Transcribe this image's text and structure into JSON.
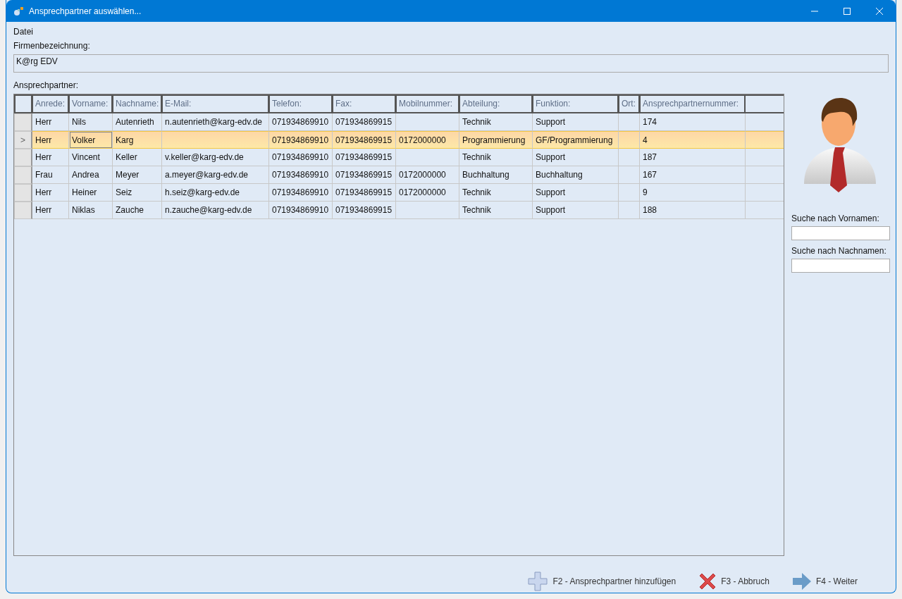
{
  "window": {
    "title": "Ansprechpartner auswählen..."
  },
  "menu": [
    {
      "label": "Datei"
    }
  ],
  "company": {
    "label": "Firmenbezeichnung:",
    "value": "K@rg EDV"
  },
  "contacts_label": "Ansprechpartner:",
  "table": {
    "current_glyph": ">",
    "columns": [
      "Anrede:",
      "Vorname:",
      "Nachname:",
      "E-Mail:",
      "Telefon:",
      "Fax:",
      "Mobilnummer:",
      "Abteilung:",
      "Funktion:",
      "Ort:",
      "Ansprechpartnernummer:"
    ],
    "rows": [
      {
        "selected": false,
        "cells": [
          {
            "text": "Herr",
            "focused": false
          },
          {
            "text": "Nils",
            "focused": false
          },
          {
            "text": "Autenrieth",
            "focused": false
          },
          {
            "text": "n.autenrieth@karg-edv.de",
            "focused": false
          },
          {
            "text": "071934869910",
            "focused": false
          },
          {
            "text": "071934869915",
            "focused": false
          },
          {
            "text": "",
            "focused": false
          },
          {
            "text": "Technik",
            "focused": false
          },
          {
            "text": "Support",
            "focused": false
          },
          {
            "text": "",
            "focused": false
          },
          {
            "text": "174",
            "focused": false
          }
        ]
      },
      {
        "selected": true,
        "cells": [
          {
            "text": "Herr",
            "focused": false
          },
          {
            "text": "Volker",
            "focused": true
          },
          {
            "text": "Karg",
            "focused": false
          },
          {
            "text": "",
            "focused": false
          },
          {
            "text": "071934869910",
            "focused": false
          },
          {
            "text": "071934869915",
            "focused": false
          },
          {
            "text": "0172000000",
            "focused": false
          },
          {
            "text": "Programmierung",
            "focused": false
          },
          {
            "text": "GF/Programmierung",
            "focused": false
          },
          {
            "text": "",
            "focused": false
          },
          {
            "text": "4",
            "focused": false
          }
        ]
      },
      {
        "selected": false,
        "cells": [
          {
            "text": "Herr",
            "focused": false
          },
          {
            "text": "Vincent",
            "focused": false
          },
          {
            "text": "Keller",
            "focused": false
          },
          {
            "text": "v.keller@karg-edv.de",
            "focused": false
          },
          {
            "text": "071934869910",
            "focused": false
          },
          {
            "text": "071934869915",
            "focused": false
          },
          {
            "text": "",
            "focused": false
          },
          {
            "text": "Technik",
            "focused": false
          },
          {
            "text": "Support",
            "focused": false
          },
          {
            "text": "",
            "focused": false
          },
          {
            "text": "187",
            "focused": false
          }
        ]
      },
      {
        "selected": false,
        "cells": [
          {
            "text": "Frau",
            "focused": false
          },
          {
            "text": "Andrea",
            "focused": false
          },
          {
            "text": "Meyer",
            "focused": false
          },
          {
            "text": "a.meyer@karg-edv.de",
            "focused": false
          },
          {
            "text": "071934869910",
            "focused": false
          },
          {
            "text": "071934869915",
            "focused": false
          },
          {
            "text": "0172000000",
            "focused": false
          },
          {
            "text": "Buchhaltung",
            "focused": false
          },
          {
            "text": "Buchhaltung",
            "focused": false
          },
          {
            "text": "",
            "focused": false
          },
          {
            "text": "167",
            "focused": false
          }
        ]
      },
      {
        "selected": false,
        "cells": [
          {
            "text": "Herr",
            "focused": false
          },
          {
            "text": "Heiner",
            "focused": false
          },
          {
            "text": "Seiz",
            "focused": false
          },
          {
            "text": "h.seiz@karg-edv.de",
            "focused": false
          },
          {
            "text": "071934869910",
            "focused": false
          },
          {
            "text": "071934869915",
            "focused": false
          },
          {
            "text": "0172000000",
            "focused": false
          },
          {
            "text": "Technik",
            "focused": false
          },
          {
            "text": "Support",
            "focused": false
          },
          {
            "text": "",
            "focused": false
          },
          {
            "text": "9",
            "focused": false
          }
        ]
      },
      {
        "selected": false,
        "cells": [
          {
            "text": "Herr",
            "focused": false
          },
          {
            "text": "Niklas",
            "focused": false
          },
          {
            "text": "Zauche",
            "focused": false
          },
          {
            "text": "n.zauche@karg-edv.de",
            "focused": false
          },
          {
            "text": "071934869910",
            "focused": false
          },
          {
            "text": "071934869915",
            "focused": false
          },
          {
            "text": "",
            "focused": false
          },
          {
            "text": "Technik",
            "focused": false
          },
          {
            "text": "Support",
            "focused": false
          },
          {
            "text": "",
            "focused": false
          },
          {
            "text": "188",
            "focused": false
          }
        ]
      }
    ]
  },
  "search": [
    {
      "label": "Suche nach Vornamen:"
    },
    {
      "label": "Suche nach Nachnamen:"
    }
  ],
  "buttons": [
    {
      "kind": "add",
      "label": "F2 - Ansprechpartner hinzufügen"
    },
    {
      "kind": "cancel",
      "label": "F3 - Abbruch"
    },
    {
      "kind": "next",
      "label": "F4 - Weiter"
    }
  ]
}
